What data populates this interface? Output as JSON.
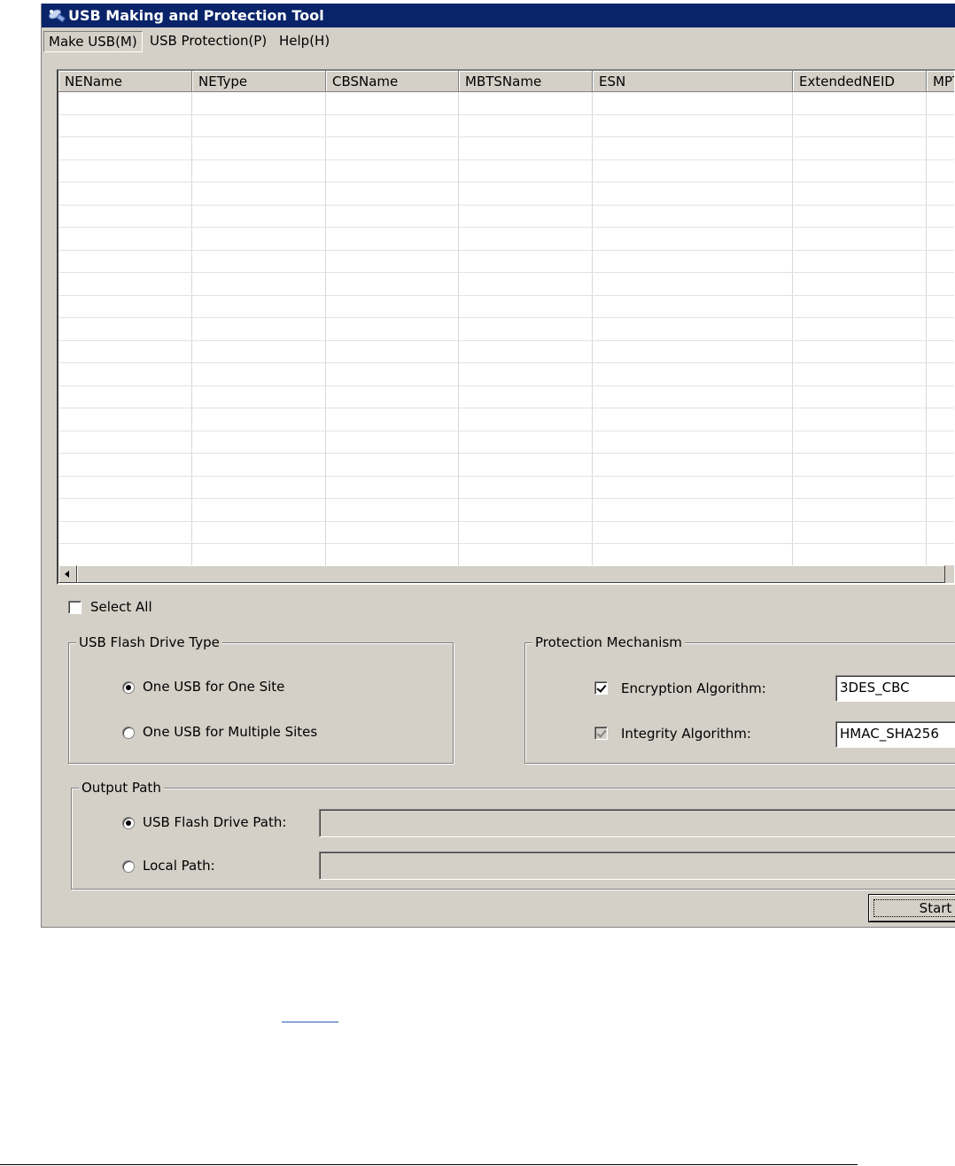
{
  "window": {
    "title": "USB Making and Protection Tool"
  },
  "menu": [
    "Make USB(M)",
    "USB Protection(P)",
    "Help(H)"
  ],
  "grid": {
    "columns": [
      "NEName",
      "NEType",
      "CBSName",
      "MBTSName",
      "ESN",
      "ExtendedNEID",
      "MPT"
    ],
    "rows": []
  },
  "select_all": {
    "label": "Select All",
    "checked": false
  },
  "usb_type": {
    "legend": "USB Flash Drive Type",
    "options": [
      {
        "label": "One USB for One Site",
        "selected": true
      },
      {
        "label": "One USB for Multiple Sites",
        "selected": false
      }
    ]
  },
  "protection": {
    "legend": "Protection Mechanism",
    "encryption": {
      "label": "Encryption Algorithm:",
      "checked": true,
      "value": "3DES_CBC"
    },
    "integrity": {
      "label": "Integrity Algorithm:",
      "checked": true,
      "disabled": true,
      "value": "HMAC_SHA256"
    }
  },
  "output": {
    "legend": "Output Path",
    "usb_path": {
      "label": "USB Flash Drive Path:",
      "selected": true,
      "value": ""
    },
    "local_path": {
      "label": "Local Path:",
      "selected": false,
      "value": ""
    }
  },
  "start_button": {
    "label": "Start"
  }
}
